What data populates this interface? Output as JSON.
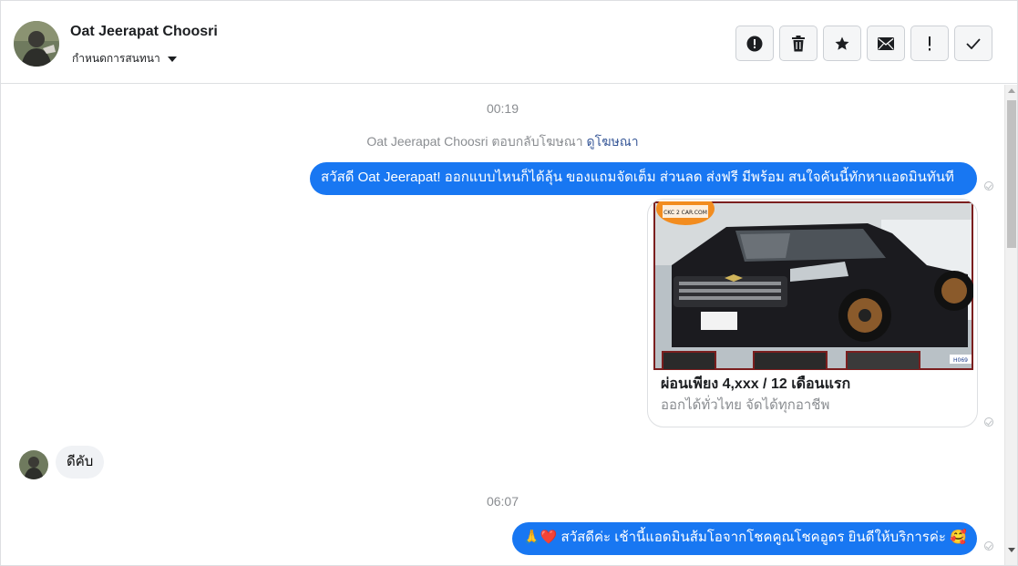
{
  "header": {
    "contact_name": "Oat Jeerapat Choosri",
    "assign_label": "กำหนดการสนทนา",
    "actions": [
      {
        "icon": "alert-circle-icon",
        "name": "mark-spam-button"
      },
      {
        "icon": "trash-icon",
        "name": "delete-button"
      },
      {
        "icon": "star-icon",
        "name": "star-button"
      },
      {
        "icon": "envelope-icon",
        "name": "mark-unread-button"
      },
      {
        "icon": "exclamation-icon",
        "name": "follow-up-button"
      },
      {
        "icon": "check-icon",
        "name": "mark-done-button"
      }
    ]
  },
  "chat": {
    "timestamp_1": "00:19",
    "reply_note": "Oat Jeerapat Choosri ตอบกลับโฆษณา",
    "reply_note_link": "ดูโฆษณา",
    "message_1": "สวัสดี Oat Jeerapat! ออกแบบไหนก็ได้ลุ้น ของแถมจัดเต็ม ส่วนลด ส่งฟรี มีพร้อม สนใจคันนี้ทักหาแอดมินทันที",
    "card": {
      "logo_text": "CKC 2 CAR.COM",
      "plate_tag": "H069",
      "title": "ผ่อนเพียง 4,xxx / 12 เดือนแรก",
      "subtitle": "ออกได้ทั่วไทย จัดได้ทุกอาชีพ"
    },
    "message_2": "ดีคับ",
    "timestamp_2": "06:07",
    "message_3_emoji": "🙏❤️",
    "message_3": "สวัสดีค่ะ เช้านี้แอดมินส้มโอจากโชคคูณโชคอูดร ยินดีให้บริการค่ะ",
    "message_3_end_emoji": "🥰"
  },
  "colors": {
    "accent": "#1877f2",
    "incoming_bubble": "#f0f2f5",
    "muted_text": "#8a8d91",
    "link": "#385898"
  }
}
